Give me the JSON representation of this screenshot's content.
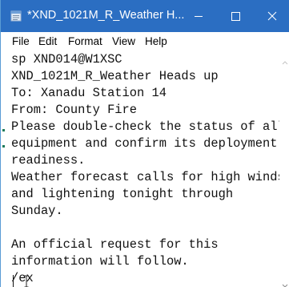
{
  "window": {
    "title": "*XND_1021M_R_Weather H...",
    "app_icon": "notepad-icon",
    "controls": {
      "minimize_icon": "minimize-icon",
      "maximize_icon": "maximize-icon",
      "close_icon": "close-icon"
    },
    "colors": {
      "titlebar": "#2b6ec2",
      "title_text": "#ffffff"
    }
  },
  "menubar": {
    "items": [
      "File",
      "Edit",
      "Format",
      "View",
      "Help"
    ]
  },
  "editor": {
    "lines": [
      "sp XND014@W1XSC",
      "XND_1021M_R_Weather Heads up",
      "To: Xanadu Station 14",
      "From: County Fire",
      "Please double-check the status of all",
      "equipment and confirm its deployment",
      "readiness.",
      "Weather forecast calls for high winds",
      "and lightening tonight through",
      "Sunday.",
      "",
      "An official request for this",
      "information will follow.",
      "/ex"
    ]
  },
  "scrollbar": {
    "up_icon": "chevron-up-icon",
    "down_icon": "chevron-down-icon"
  }
}
